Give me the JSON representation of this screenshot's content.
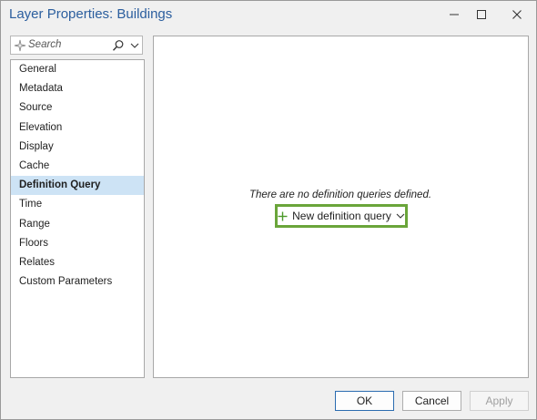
{
  "window": {
    "title": "Layer Properties: Buildings"
  },
  "search": {
    "placeholder": "Search"
  },
  "sidebar": {
    "items": [
      {
        "label": "General"
      },
      {
        "label": "Metadata"
      },
      {
        "label": "Source"
      },
      {
        "label": "Elevation"
      },
      {
        "label": "Display"
      },
      {
        "label": "Cache"
      },
      {
        "label": "Definition Query",
        "selected": true
      },
      {
        "label": "Time"
      },
      {
        "label": "Range"
      },
      {
        "label": "Floors"
      },
      {
        "label": "Relates"
      },
      {
        "label": "Custom Parameters"
      }
    ]
  },
  "main": {
    "empty_message": "There are no definition queries defined.",
    "new_query_label": "New definition query"
  },
  "footer": {
    "ok_label": "OK",
    "cancel_label": "Cancel",
    "apply_label": "Apply"
  },
  "colors": {
    "title": "#2b5e9e",
    "selected_bg": "#cde3f5",
    "highlight_border": "#6aa53a",
    "plus_icon": "#4c9a2a"
  },
  "icons": [
    "minimize-icon",
    "maximize-icon",
    "close-icon",
    "sparkle-icon",
    "search-icon",
    "chevron-down-icon",
    "plus-icon"
  ]
}
